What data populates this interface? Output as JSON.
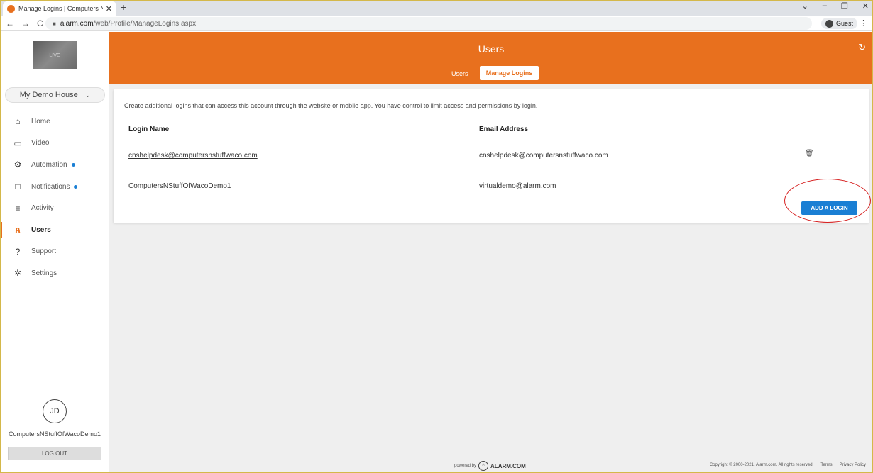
{
  "browser": {
    "tab_title": "Manage Logins | Computers N' S",
    "url_host": "alarm.com",
    "url_path": "/web/Profile/ManageLogins.aspx",
    "profile_label": "Guest"
  },
  "sidebar": {
    "logo_text": "LIVE",
    "location": "My Demo House",
    "items": [
      {
        "label": "Home",
        "icon": "home-icon"
      },
      {
        "label": "Video",
        "icon": "video-camera-icon"
      },
      {
        "label": "Automation",
        "icon": "automation-icon",
        "dot": true
      },
      {
        "label": "Notifications",
        "icon": "notifications-icon",
        "dot": true
      },
      {
        "label": "Activity",
        "icon": "activity-icon"
      },
      {
        "label": "Users",
        "icon": "users-icon",
        "active": true
      },
      {
        "label": "Support",
        "icon": "support-icon"
      },
      {
        "label": "Settings",
        "icon": "gear-icon"
      }
    ],
    "avatar_initials": "JD",
    "user_name": "ComputersNStuffOfWacoDemo1",
    "logout_label": "LOG OUT"
  },
  "header": {
    "title": "Users",
    "tabs": [
      "Users",
      "Manage Logins"
    ],
    "active_tab": "Manage Logins"
  },
  "main": {
    "description": "Create additional logins that can access this account through the website or mobile app. You have control to limit access and permissions by login.",
    "columns": [
      "Login Name",
      "Email Address"
    ],
    "rows": [
      {
        "login": "cnshelpdesk@computersnstuffwaco.com",
        "email": "cnshelpdesk@computersnstuffwaco.com"
      },
      {
        "login": "ComputersNStuffOfWacoDemo1",
        "email": "virtualdemo@alarm.com"
      }
    ],
    "add_button": "ADD A LOGIN"
  },
  "footer": {
    "powered_by": "powered by",
    "brand": "ALARM.COM",
    "copyright": "Copyright © 2000-2021. Alarm.com. All rights reserved.",
    "terms": "Terms",
    "privacy": "Privacy Policy"
  },
  "colors": {
    "accent": "#e8701e",
    "button": "#1a7fd4",
    "notification_dot": "#1a7fd4",
    "highlight_ring": "#d62020"
  }
}
